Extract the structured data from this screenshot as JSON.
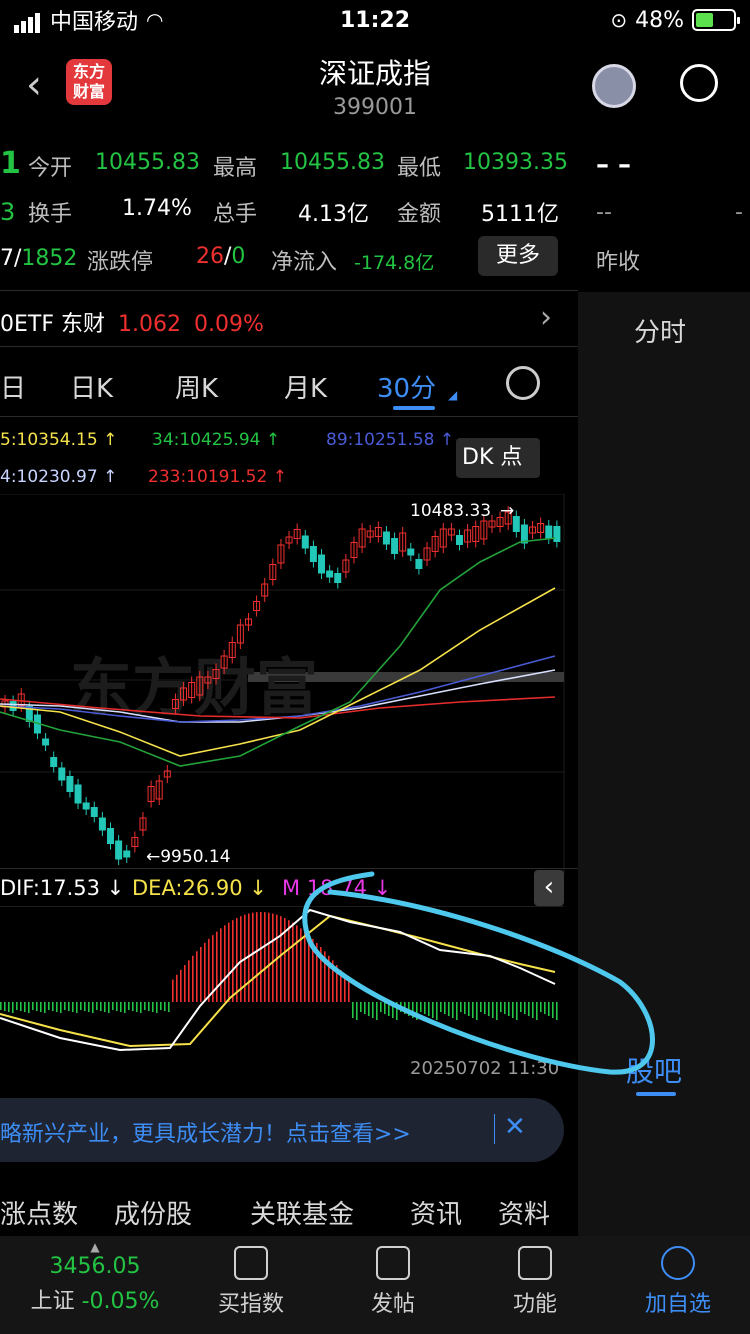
{
  "status_bar": {
    "carrier": "中国移动",
    "time": "11:22",
    "battery": "48%",
    "battery_level": 0.48
  },
  "nav": {
    "title": "深证成指",
    "code": "399001",
    "logo_text": "东方财富"
  },
  "quote": {
    "open_label": "今开",
    "open": "10455.83",
    "high_label": "最高",
    "high": "10455.83",
    "low_label": "最低",
    "low": "10393.35",
    "turnover_label": "换手",
    "turnover": "1.74%",
    "volume_label": "总手",
    "volume": "4.13亿",
    "amount_label": "金额",
    "amount": "5111亿",
    "updown_prefix": "7/",
    "updown_down": "1852",
    "limit_label": "涨跌停",
    "limit_up": "26",
    "limit_sep": "/",
    "limit_down": "0",
    "netflow_label": "净流入",
    "netflow": "-174.8亿",
    "more_label": "更多",
    "left_frag_1": "1",
    "left_frag_2": "3",
    "right_dash": "– –",
    "right_dash2": "--",
    "right_dash3": "-",
    "prev_close_label": "昨收"
  },
  "etf": {
    "name": "0ETF 东财",
    "price": "1.062",
    "change": "0.09%"
  },
  "chart_tabs": {
    "day_frag": "日",
    "daily": "日K",
    "weekly": "周K",
    "monthly": "月K",
    "active": "30分"
  },
  "right_panel": {
    "tab_minute": "分时",
    "tab_guba": "股吧"
  },
  "ma_legend": {
    "ma5": "5:10354.15 ↑",
    "ma34": "34:10425.94 ↑",
    "ma89": "89:10251.58 ↑",
    "ma4": "4:10230.97 ↑",
    "ma233": "233:10191.52 ↑",
    "dk_button": "DK 点"
  },
  "chart_labels": {
    "high_mark": "10483.33",
    "low_mark": "←9950.14",
    "watermark": "东方财富",
    "date": "20250702 11:30"
  },
  "macd": {
    "dif": "DIF:17.53 ↓",
    "dea": "DEA:26.90 ↓",
    "m_prefix": "M",
    "m_value": "18.74 ↓"
  },
  "banner": {
    "text": "略新兴产业，更具成长潜力！点击查看>>"
  },
  "bottom_tabs": [
    "涨点数",
    "成份股",
    "关联基金",
    "资讯",
    "资料"
  ],
  "tabbar": {
    "index_value": "3456.05",
    "index_label": "上证",
    "index_change": "-0.05%",
    "buy_index": "买指数",
    "post": "发帖",
    "function": "功能",
    "add_watch": "加自选"
  },
  "colors": {
    "up": "#f0302f",
    "down": "#23c343",
    "accent": "#3d8df5",
    "macd_dea": "#f5e14a",
    "annotation": "#4fc8ee"
  }
}
